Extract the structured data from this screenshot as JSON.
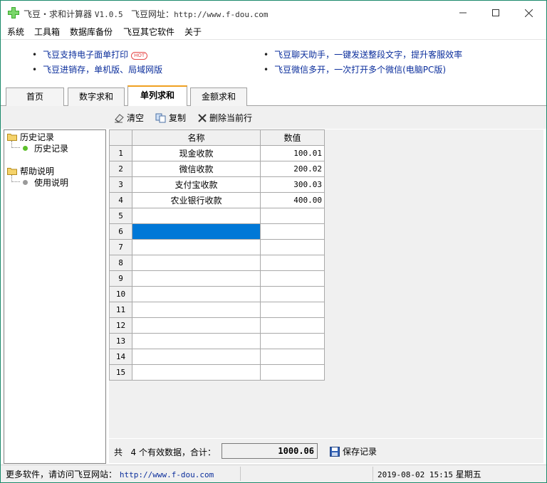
{
  "window": {
    "title_app": "飞豆・求和计算器",
    "title_version": "V1.0.5",
    "title_site_label": "飞豆网址：",
    "title_site_url": "http://www.f-dou.com"
  },
  "menu": [
    "系统",
    "工具箱",
    "数据库备份",
    "飞豆其它软件",
    "关于"
  ],
  "ads": [
    {
      "text": "飞豆支持电子面单打印",
      "badge": "HOT"
    },
    {
      "text": "飞豆进销存，单机版、局域网版"
    },
    {
      "text": "飞豆聊天助手，一键发送整段文字，提升客服效率"
    },
    {
      "text": "飞豆微信多开，一次打开多个微信(电脑PC版)"
    }
  ],
  "tabs": [
    "首页",
    "数字求和",
    "单列求和",
    "金额求和"
  ],
  "active_tab": "单列求和",
  "toolbar": {
    "clear": "清空",
    "copy": "复制",
    "delete_row": "删除当前行"
  },
  "tree": {
    "history_folder": "历史记录",
    "history_item": "历史记录",
    "help_folder": "帮助说明",
    "help_item": "使用说明"
  },
  "grid": {
    "columns": [
      "名称",
      "数值"
    ],
    "rows": [
      {
        "n": "1",
        "name": "现金收款",
        "value": "100.01"
      },
      {
        "n": "2",
        "name": "微信收款",
        "value": "200.02"
      },
      {
        "n": "3",
        "name": "支付宝收款",
        "value": "300.03"
      },
      {
        "n": "4",
        "name": "农业银行收款",
        "value": "400.00"
      },
      {
        "n": "5",
        "name": "",
        "value": ""
      },
      {
        "n": "6",
        "name": "",
        "value": "",
        "selected": true
      },
      {
        "n": "7",
        "name": "",
        "value": ""
      },
      {
        "n": "8",
        "name": "",
        "value": ""
      },
      {
        "n": "9",
        "name": "",
        "value": ""
      },
      {
        "n": "10",
        "name": "",
        "value": ""
      },
      {
        "n": "11",
        "name": "",
        "value": ""
      },
      {
        "n": "12",
        "name": "",
        "value": ""
      },
      {
        "n": "13",
        "name": "",
        "value": ""
      },
      {
        "n": "14",
        "name": "",
        "value": ""
      },
      {
        "n": "15",
        "name": "",
        "value": ""
      }
    ],
    "selection_color": "#0078d7"
  },
  "summary": {
    "prefix": "共",
    "count": "4",
    "suffix": "个有效数据，合计：",
    "total": "1000.06",
    "save_label": "保存记录"
  },
  "status": {
    "left_text": "更多软件，请访问飞豆网站：",
    "left_url": "http://www.f-dou.com",
    "datetime": "2019-08-02 15:15",
    "weekday": "星期五"
  },
  "colors": {
    "accent_border": "#1b8a6b",
    "link": "#0b2e9c",
    "tab_active_top": "#f0a020",
    "hot_badge": "#e64a4a"
  }
}
